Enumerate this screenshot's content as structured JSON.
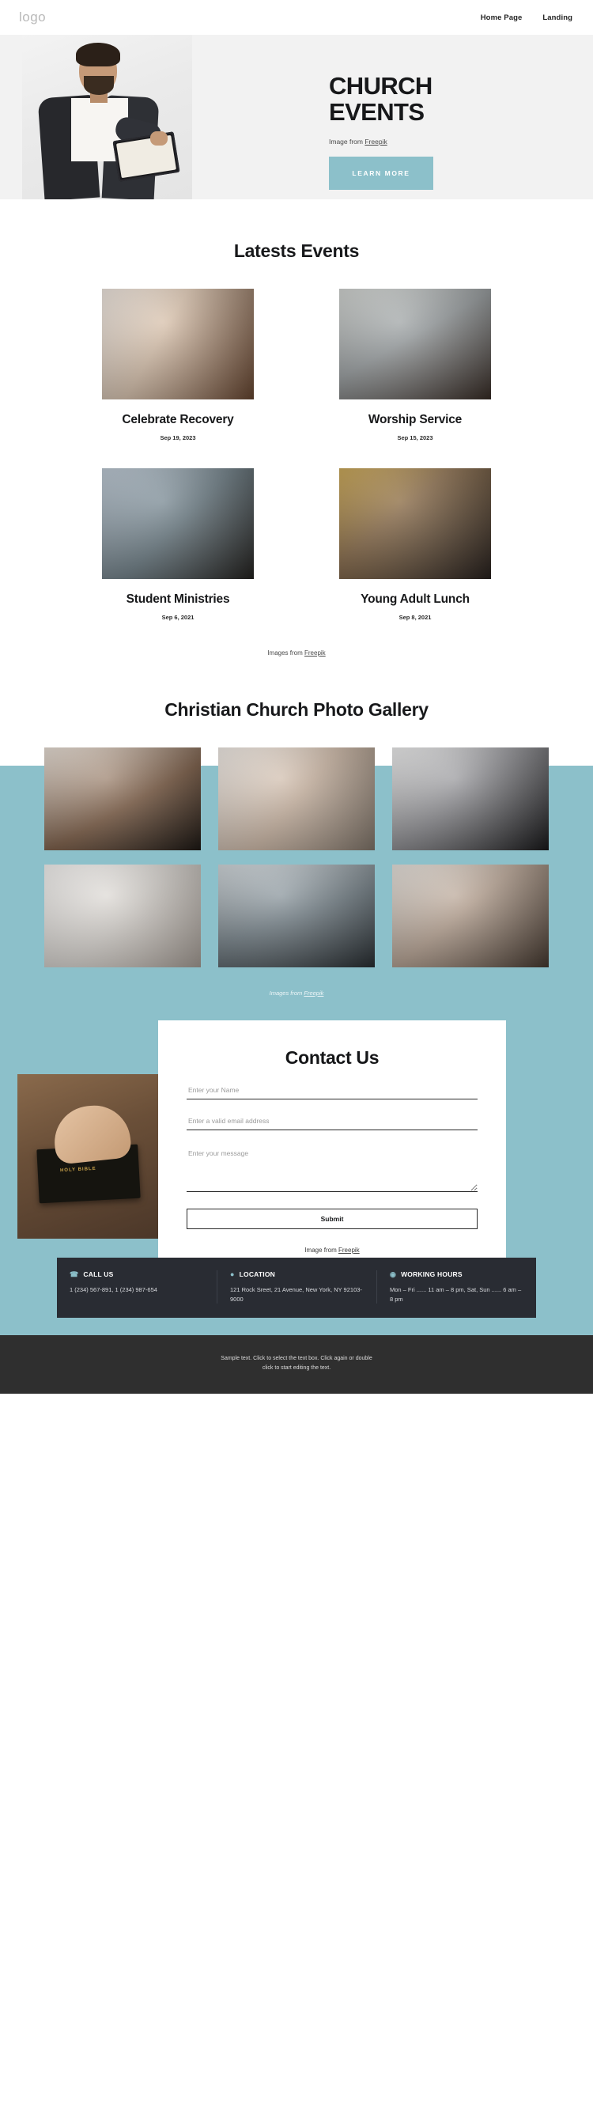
{
  "header": {
    "logo": "logo",
    "nav": [
      {
        "label": "Home Page"
      },
      {
        "label": "Landing"
      }
    ]
  },
  "hero": {
    "title_line1": "CHURCH",
    "title_line2": "EVENTS",
    "credit_prefix": "Image from ",
    "credit_link": "Freepik",
    "cta_label": "LEARN MORE",
    "cta_color": "#8cc0ca"
  },
  "events": {
    "title": "Latests Events",
    "cards": [
      {
        "title": "Celebrate Recovery",
        "date": "Sep 19, 2023"
      },
      {
        "title": "Worship Service",
        "date": "Sep 15, 2023"
      },
      {
        "title": "Student Ministries",
        "date": "Sep 6, 2021"
      },
      {
        "title": "Young Adult Lunch",
        "date": "Sep 8, 2021"
      }
    ],
    "credit_prefix": "Images from ",
    "credit_link": "Freepik"
  },
  "gallery": {
    "title": "Christian Church Photo Gallery",
    "credit_prefix": "Images from ",
    "credit_link": "Freepik",
    "band_color": "#8cc0ca",
    "item_count": 6
  },
  "contact": {
    "title": "Contact Us",
    "name_placeholder": "Enter your Name",
    "email_placeholder": "Enter a valid email address",
    "message_placeholder": "Enter your message",
    "submit_label": "Submit",
    "credit_prefix": "Image from ",
    "credit_link": "Freepik"
  },
  "info": {
    "call": {
      "icon": "phone-icon",
      "heading": "CALL US",
      "body": "1 (234) 567-891, 1 (234) 987-654"
    },
    "location": {
      "icon": "map-pin-icon",
      "heading": "LOCATION",
      "body": "121 Rock Sreet, 21 Avenue, New York, NY 92103-9000"
    },
    "hours": {
      "icon": "clock-icon",
      "heading": "WORKING HOURS",
      "body": "Mon – Fri ...... 11 am – 8 pm, Sat, Sun  ...... 6 am – 8 pm"
    }
  },
  "footer": {
    "line1": "Sample text. Click to select the text box. Click again or double",
    "line2": "click to start editing the text."
  }
}
